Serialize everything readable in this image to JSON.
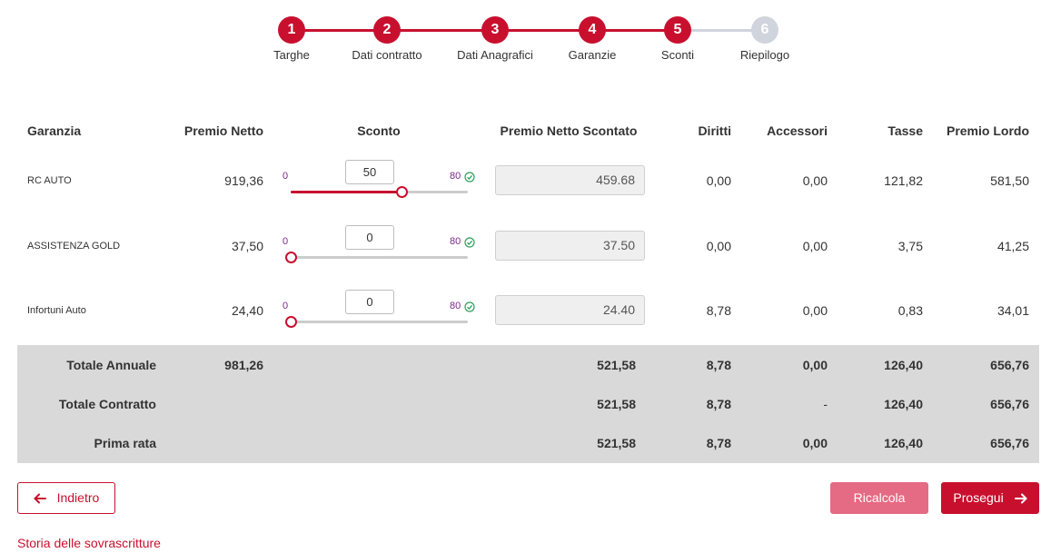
{
  "colors": {
    "accent": "#c8102e",
    "inactive_step": "#d0d4dc",
    "totals_bg": "#d9d9d9"
  },
  "stepper": {
    "current_step": 5,
    "steps": [
      {
        "number": "1",
        "label": "Targhe"
      },
      {
        "number": "2",
        "label": "Dati contratto"
      },
      {
        "number": "3",
        "label": "Dati Anagrafici"
      },
      {
        "number": "4",
        "label": "Garanzie"
      },
      {
        "number": "5",
        "label": "Sconti"
      },
      {
        "number": "6",
        "label": "Riepilogo"
      }
    ]
  },
  "table": {
    "headers": {
      "garanzia": "Garanzia",
      "premio_netto": "Premio Netto",
      "sconto": "Sconto",
      "premio_netto_scontato": "Premio Netto Scontato",
      "diritti": "Diritti",
      "accessori": "Accessori",
      "tasse": "Tasse",
      "premio_lordo": "Premio Lordo"
    },
    "rows": [
      {
        "garanzia": "RC AUTO",
        "premio_netto": "919,36",
        "sconto": "50",
        "sconto_min": "0",
        "sconto_max": "80",
        "sconto_fraction": 0.625,
        "premio_netto_scontato": "459.68",
        "diritti": "0,00",
        "accessori": "0,00",
        "tasse": "121,82",
        "premio_lordo": "581,50"
      },
      {
        "garanzia": "ASSISTENZA GOLD",
        "premio_netto": "37,50",
        "sconto": "0",
        "sconto_min": "0",
        "sconto_max": "80",
        "sconto_fraction": 0,
        "premio_netto_scontato": "37.50",
        "diritti": "0,00",
        "accessori": "0,00",
        "tasse": "3,75",
        "premio_lordo": "41,25"
      },
      {
        "garanzia": "Infortuni Auto",
        "premio_netto": "24,40",
        "sconto": "0",
        "sconto_min": "0",
        "sconto_max": "80",
        "sconto_fraction": 0,
        "premio_netto_scontato": "24.40",
        "diritti": "8,78",
        "accessori": "0,00",
        "tasse": "0,83",
        "premio_lordo": "34,01"
      }
    ],
    "totals": [
      {
        "label": "Totale Annuale",
        "premio_netto": "981,26",
        "premio_netto_scontato": "521,58",
        "diritti": "8,78",
        "accessori": "0,00",
        "tasse": "126,40",
        "premio_lordo": "656,76"
      },
      {
        "label": "Totale Contratto",
        "premio_netto": "",
        "premio_netto_scontato": "521,58",
        "diritti": "8,78",
        "accessori": "-",
        "tasse": "126,40",
        "premio_lordo": "656,76"
      },
      {
        "label": "Prima rata",
        "premio_netto": "",
        "premio_netto_scontato": "521,58",
        "diritti": "8,78",
        "accessori": "0,00",
        "tasse": "126,40",
        "premio_lordo": "656,76"
      }
    ]
  },
  "actions": {
    "back_label": "Indietro",
    "recalc_label": "Ricalcola",
    "next_label": "Prosegui",
    "history_link": "Storia delle sovrascritture"
  }
}
